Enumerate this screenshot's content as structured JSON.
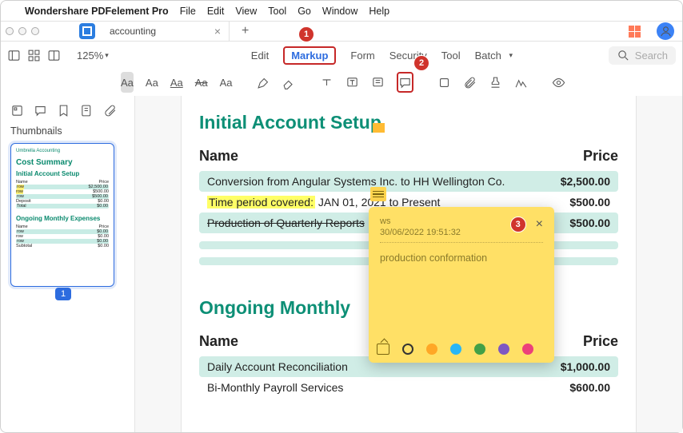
{
  "menubar": {
    "app": "Wondershare PDFelement Pro",
    "items": [
      "File",
      "Edit",
      "View",
      "Tool",
      "Go",
      "Window",
      "Help"
    ]
  },
  "tabbar": {
    "tab_title": "accounting"
  },
  "toolbar": {
    "zoom": "125%",
    "tabs": [
      "Edit",
      "Markup",
      "Form",
      "Security",
      "Tool",
      "Batch"
    ],
    "active_tab": "Markup",
    "search_placeholder": "Search"
  },
  "badges": {
    "b1": "1",
    "b2": "2",
    "b3": "3"
  },
  "side": {
    "title": "Thumbnails",
    "page_num": "1"
  },
  "thumb": {
    "brand": "Umbrella Accounting",
    "title": "Cost Summary",
    "h1": "Initial Account Setup",
    "h2": "Ongoing Monthly Expenses"
  },
  "doc": {
    "h1": "Initial Account Setup",
    "col_name": "Name",
    "col_price": "Price",
    "rows": [
      {
        "name_a": "Conversion from Angular Systems Inc. to HH Wellington Co.",
        "price": "$2,500.00"
      },
      {
        "name_hl": "Time period covered:",
        "name_b": " JAN 01, 2021 to Present",
        "price": "$500.00"
      },
      {
        "name_strike": "Production of Quarterly Reports",
        "price": "$500.00"
      }
    ],
    "h2": "Ongoing Monthly",
    "rows2": [
      {
        "name": "Daily Account Reconciliation",
        "price": "$1,000.00"
      },
      {
        "name": "Bi-Monthly Payroll Services",
        "price": "$600.00"
      }
    ]
  },
  "note": {
    "author": "ws",
    "timestamp": "30/06/2022 19:51:32",
    "message": "production conformation",
    "colors": [
      "#ffa726",
      "#29b6f6",
      "#43a047",
      "#7e57c2",
      "#ec407a"
    ]
  }
}
